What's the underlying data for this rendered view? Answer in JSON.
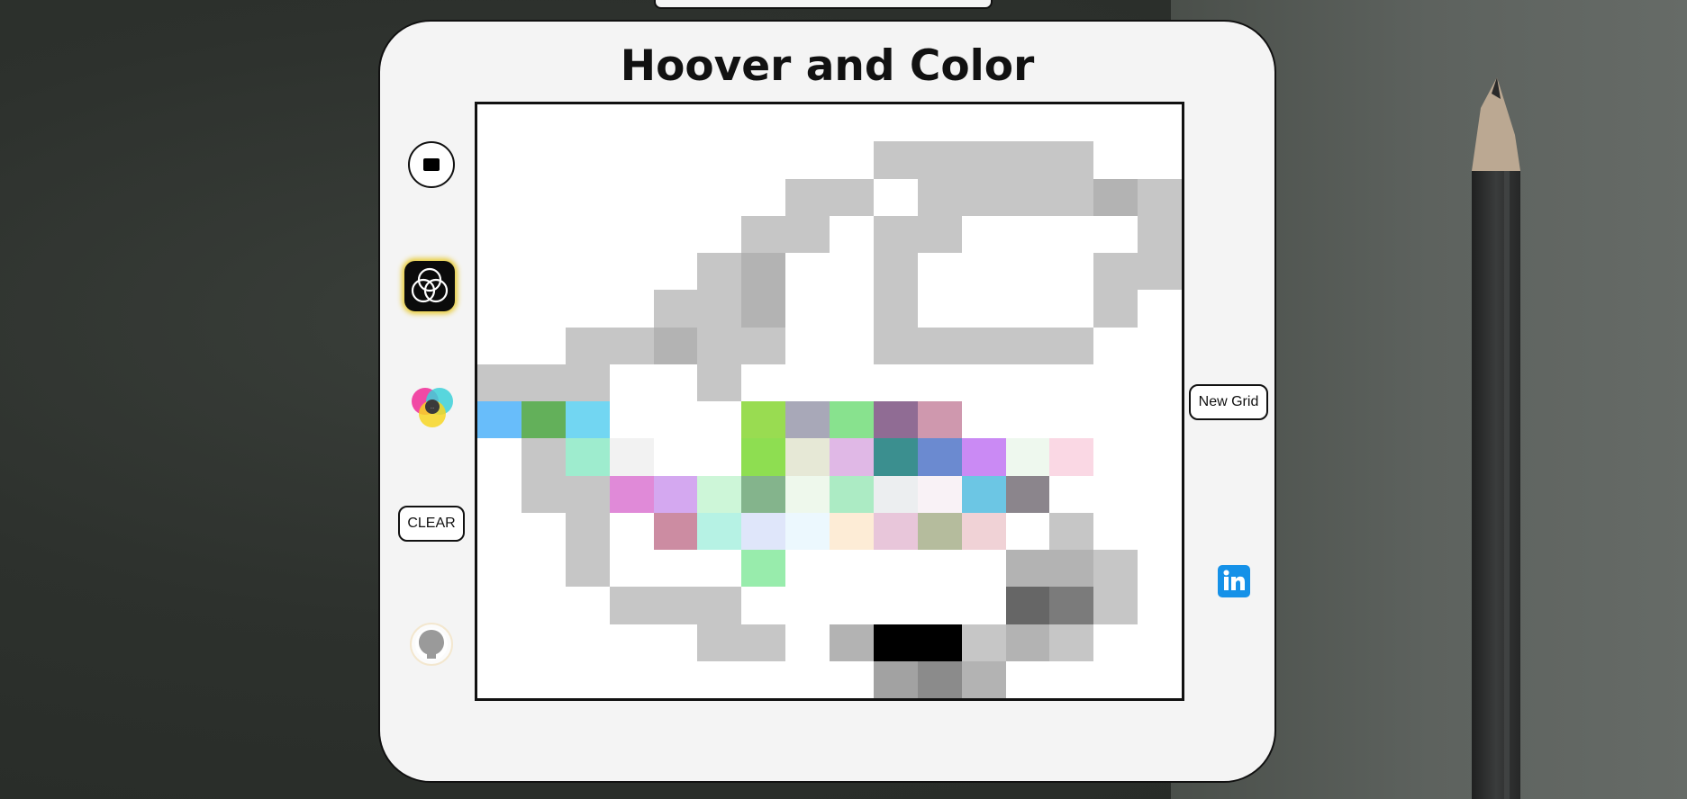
{
  "app": {
    "title": "Hoover and Color"
  },
  "sidebar": {
    "stop_icon": "stop-icon",
    "rgb_icon": "rgb-circles-icon",
    "cmy_icon": "cmy-circles-icon",
    "clear_label": "CLEAR",
    "github_icon": "github-icon"
  },
  "right": {
    "new_grid_label": "New Grid",
    "linkedin_icon": "linkedin-icon"
  },
  "colors": {
    "panel": "#f4f4f4",
    "rgb_glow": "#e8cc3a",
    "linkedin": "#1591e8"
  },
  "grid": {
    "cols": 16,
    "rows": 16,
    "cells": [
      [
        "#ffffff",
        "#ffffff",
        "#ffffff",
        "#ffffff",
        "#ffffff",
        "#ffffff",
        "#ffffff",
        "#ffffff",
        "#ffffff",
        "#ffffff",
        "#ffffff",
        "#ffffff",
        "#ffffff",
        "#ffffff",
        "#ffffff",
        "#ffffff"
      ],
      [
        "#ffffff",
        "#ffffff",
        "#ffffff",
        "#ffffff",
        "#ffffff",
        "#ffffff",
        "#ffffff",
        "#ffffff",
        "#ffffff",
        "#c6c6c6",
        "#c6c6c6",
        "#c6c6c6",
        "#c6c6c6",
        "#c6c6c6",
        "#ffffff",
        "#ffffff"
      ],
      [
        "#ffffff",
        "#ffffff",
        "#ffffff",
        "#ffffff",
        "#ffffff",
        "#ffffff",
        "#ffffff",
        "#c6c6c6",
        "#c6c6c6",
        "#ffffff",
        "#c6c6c6",
        "#c6c6c6",
        "#c6c6c6",
        "#c6c6c6",
        "#b3b3b3",
        "#c6c6c6"
      ],
      [
        "#ffffff",
        "#ffffff",
        "#ffffff",
        "#ffffff",
        "#ffffff",
        "#ffffff",
        "#c6c6c6",
        "#c6c6c6",
        "#ffffff",
        "#c6c6c6",
        "#c6c6c6",
        "#ffffff",
        "#ffffff",
        "#ffffff",
        "#ffffff",
        "#c6c6c6"
      ],
      [
        "#ffffff",
        "#ffffff",
        "#ffffff",
        "#ffffff",
        "#ffffff",
        "#c6c6c6",
        "#b3b3b3",
        "#ffffff",
        "#ffffff",
        "#c6c6c6",
        "#ffffff",
        "#ffffff",
        "#ffffff",
        "#ffffff",
        "#c6c6c6",
        "#c6c6c6"
      ],
      [
        "#ffffff",
        "#ffffff",
        "#ffffff",
        "#ffffff",
        "#c6c6c6",
        "#c6c6c6",
        "#b3b3b3",
        "#ffffff",
        "#ffffff",
        "#c6c6c6",
        "#ffffff",
        "#ffffff",
        "#ffffff",
        "#ffffff",
        "#c6c6c6",
        "#ffffff"
      ],
      [
        "#ffffff",
        "#ffffff",
        "#c6c6c6",
        "#c6c6c6",
        "#b3b3b3",
        "#c6c6c6",
        "#c6c6c6",
        "#ffffff",
        "#ffffff",
        "#c6c6c6",
        "#c6c6c6",
        "#c6c6c6",
        "#c6c6c6",
        "#c6c6c6",
        "#ffffff",
        "#ffffff"
      ],
      [
        "#c6c6c6",
        "#c6c6c6",
        "#c6c6c6",
        "#ffffff",
        "#ffffff",
        "#c6c6c6",
        "#ffffff",
        "#ffffff",
        "#ffffff",
        "#ffffff",
        "#ffffff",
        "#ffffff",
        "#ffffff",
        "#ffffff",
        "#ffffff",
        "#ffffff"
      ],
      [
        "#68bdfa",
        "#63b05a",
        "#72d6f2",
        "#ffffff",
        "#ffffff",
        "#ffffff",
        "#99dc51",
        "#a8a8b8",
        "#88e28e",
        "#906c94",
        "#cf98ae",
        "#ffffff",
        "#ffffff",
        "#ffffff",
        "#ffffff",
        "#ffffff"
      ],
      [
        "#ffffff",
        "#c6c6c6",
        "#9eecce",
        "#f2f2f2",
        "#ffffff",
        "#ffffff",
        "#8ede51",
        "#e6e8d6",
        "#e0b8e6",
        "#3b8f8f",
        "#6b8ad0",
        "#ca8af4",
        "#eef8ee",
        "#fad8e4",
        "#ffffff",
        "#ffffff"
      ],
      [
        "#ffffff",
        "#c6c6c6",
        "#c6c6c6",
        "#e08ad8",
        "#d4a8f0",
        "#cdf6d8",
        "#84b48c",
        "#eef8ec",
        "#acebc4",
        "#eceef0",
        "#f9f2f6",
        "#6cc6e4",
        "#8b858c",
        "#ffffff",
        "#ffffff",
        "#ffffff"
      ],
      [
        "#ffffff",
        "#ffffff",
        "#c6c6c6",
        "#ffffff",
        "#cc8ca2",
        "#b6f2e4",
        "#dfe6fa",
        "#ecf8fe",
        "#fdecd6",
        "#e8c6da",
        "#b5bc9d",
        "#f0d2d6",
        "#ffffff",
        "#c6c6c6",
        "#ffffff",
        "#ffffff"
      ],
      [
        "#ffffff",
        "#ffffff",
        "#c6c6c6",
        "#ffffff",
        "#ffffff",
        "#ffffff",
        "#98ecac",
        "#ffffff",
        "#ffffff",
        "#ffffff",
        "#ffffff",
        "#ffffff",
        "#b3b3b3",
        "#b3b3b3",
        "#c6c6c6",
        "#ffffff"
      ],
      [
        "#ffffff",
        "#ffffff",
        "#ffffff",
        "#c6c6c6",
        "#c6c6c6",
        "#c6c6c6",
        "#ffffff",
        "#ffffff",
        "#ffffff",
        "#ffffff",
        "#ffffff",
        "#ffffff",
        "#666666",
        "#7b7b7b",
        "#c6c6c6",
        "#ffffff"
      ],
      [
        "#ffffff",
        "#ffffff",
        "#ffffff",
        "#ffffff",
        "#ffffff",
        "#c6c6c6",
        "#c6c6c6",
        "#ffffff",
        "#b3b3b3",
        "#000000",
        "#000000",
        "#c6c6c6",
        "#b3b3b3",
        "#c6c6c6",
        "#ffffff",
        "#ffffff"
      ],
      [
        "#ffffff",
        "#ffffff",
        "#ffffff",
        "#ffffff",
        "#ffffff",
        "#ffffff",
        "#ffffff",
        "#ffffff",
        "#ffffff",
        "#a2a2a2",
        "#8b8b8b",
        "#b3b3b3",
        "#ffffff",
        "#ffffff",
        "#ffffff",
        "#ffffff"
      ]
    ]
  }
}
